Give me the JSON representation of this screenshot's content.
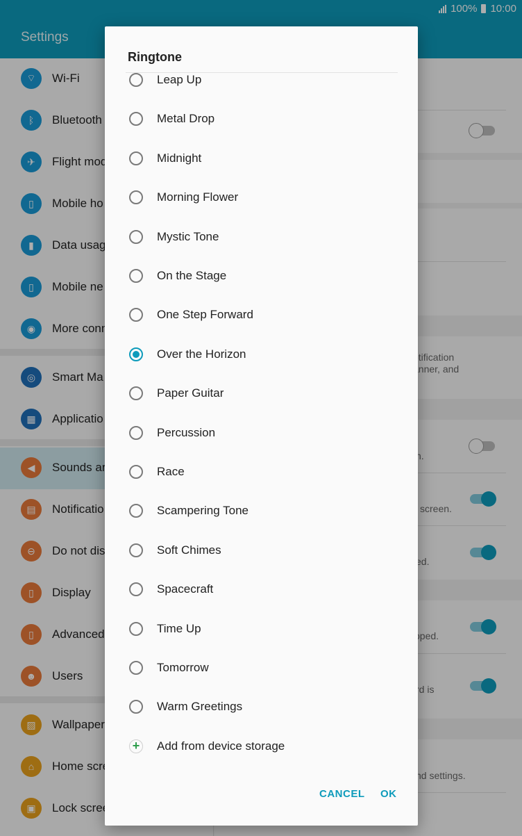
{
  "status": {
    "battery_pct": "100%",
    "time": "10:00"
  },
  "header": {
    "title": "Settings"
  },
  "left_list": [
    {
      "label": "Wi-Fi",
      "color": "#1a9ad6",
      "glyph": "⌔",
      "icon": "wifi-icon"
    },
    {
      "label": "Bluetooth",
      "color": "#1a9ad6",
      "glyph": "ᛒ",
      "icon": "bluetooth-icon"
    },
    {
      "label": "Flight mod",
      "color": "#1a9ad6",
      "glyph": "✈",
      "icon": "airplane-icon"
    },
    {
      "label": "Mobile ho",
      "color": "#1a9ad6",
      "glyph": "▯",
      "icon": "hotspot-icon"
    },
    {
      "label": "Data usag",
      "color": "#1a9ad6",
      "glyph": "▮",
      "icon": "data-usage-icon"
    },
    {
      "label": "Mobile ne",
      "color": "#1a9ad6",
      "glyph": "▯",
      "icon": "mobile-network-icon"
    },
    {
      "label": "More conn",
      "color": "#1a9ad6",
      "glyph": "◉",
      "icon": "more-connections-icon"
    },
    {
      "label": "Smart Ma",
      "color": "#1f6fb8",
      "glyph": "◎",
      "icon": "smart-manager-icon"
    },
    {
      "label": "Applicatio",
      "color": "#1f6fb8",
      "glyph": "▦",
      "icon": "applications-icon"
    },
    {
      "label": "Sounds ar",
      "color": "#e8793a",
      "glyph": "◀",
      "icon": "sounds-icon"
    },
    {
      "label": "Notificatio",
      "color": "#e8793a",
      "glyph": "▤",
      "icon": "notifications-icon"
    },
    {
      "label": "Do not dis",
      "color": "#e8793a",
      "glyph": "⊖",
      "icon": "do-not-disturb-icon"
    },
    {
      "label": "Display",
      "color": "#e8793a",
      "glyph": "▯",
      "icon": "display-icon"
    },
    {
      "label": "Advanced",
      "color": "#e8793a",
      "glyph": "▯",
      "icon": "advanced-icon"
    },
    {
      "label": "Users",
      "color": "#e8793a",
      "glyph": "☻",
      "icon": "users-icon"
    },
    {
      "label": "Wallpaper",
      "color": "#e9a11d",
      "glyph": "▨",
      "icon": "wallpaper-icon"
    },
    {
      "label": "Home scre",
      "color": "#e9a11d",
      "glyph": "⌂",
      "icon": "home-screen-icon"
    },
    {
      "label": "Lock scree",
      "color": "#e9a11d",
      "glyph": "▣",
      "icon": "lock-screen-icon"
    }
  ],
  "right_pane": {
    "texts": [
      "otification",
      "anner, and",
      "n.",
      "screen.",
      "ed.",
      "oped.",
      "rd is",
      "nd settings."
    ]
  },
  "dialog": {
    "title": "Ringtone",
    "options": [
      {
        "label": "Leap Up",
        "checked": false
      },
      {
        "label": "Metal Drop",
        "checked": false
      },
      {
        "label": "Midnight",
        "checked": false
      },
      {
        "label": "Morning Flower",
        "checked": false
      },
      {
        "label": "Mystic Tone",
        "checked": false
      },
      {
        "label": "On the Stage",
        "checked": false
      },
      {
        "label": "One Step Forward",
        "checked": false
      },
      {
        "label": "Over the Horizon",
        "checked": true
      },
      {
        "label": "Paper Guitar",
        "checked": false
      },
      {
        "label": "Percussion",
        "checked": false
      },
      {
        "label": "Race",
        "checked": false
      },
      {
        "label": "Scampering Tone",
        "checked": false
      },
      {
        "label": "Soft Chimes",
        "checked": false
      },
      {
        "label": "Spacecraft",
        "checked": false
      },
      {
        "label": "Time Up",
        "checked": false
      },
      {
        "label": "Tomorrow",
        "checked": false
      },
      {
        "label": "Warm Greetings",
        "checked": false
      }
    ],
    "add_label": "Add from device storage",
    "cancel_label": "CANCEL",
    "ok_label": "OK"
  }
}
